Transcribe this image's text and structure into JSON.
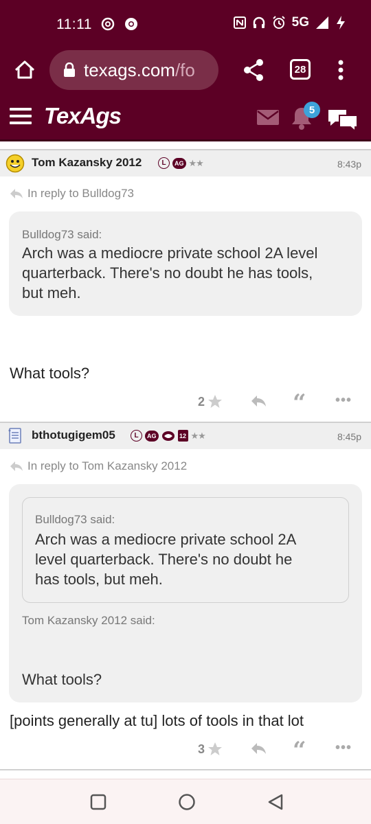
{
  "status_bar": {
    "time": "11:11",
    "network": "5G"
  },
  "browser": {
    "url_domain": "texags.com",
    "url_path": "/fo",
    "tab_count": "28"
  },
  "site": {
    "logo": "TexAgs",
    "notification_count": "5"
  },
  "posts": [
    {
      "username": "Tom Kazansky 2012",
      "time": "8:43p",
      "badges": {
        "l": "L",
        "ag": "AG",
        "stars": "★★"
      },
      "reply_to": "In reply to Bulldog73",
      "quote": {
        "said": "Bulldog73 said:",
        "lines": [
          "Arch was a mediocre private school 2A level",
          "quarterback. There's no doubt he has tools,",
          "but meh."
        ]
      },
      "body": "What tools?",
      "likes": "2"
    },
    {
      "username": "bthotugigem05",
      "time": "8:45p",
      "badges": {
        "l": "L",
        "ag": "AG",
        "twelve": "12",
        "stars": "★★"
      },
      "reply_to": "In reply to Tom Kazansky 2012",
      "nested_quote": {
        "said": "Bulldog73 said:",
        "lines": [
          "Arch was a mediocre private school 2A",
          "level quarterback. There's no doubt he",
          "has tools, but meh."
        ]
      },
      "quote": {
        "said": "Tom Kazansky 2012 said:",
        "text": "What tools?"
      },
      "body": "[points generally at tu] lots of tools in that lot",
      "likes": "3"
    }
  ],
  "colors": {
    "brand": "#5c0025",
    "badge_blue": "#3ea3da",
    "quote_bg": "#f0f0f0"
  }
}
